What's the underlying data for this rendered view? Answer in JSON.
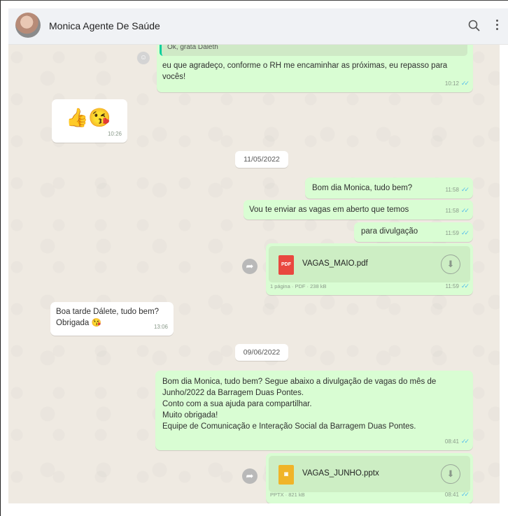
{
  "header": {
    "contact_name": "Monica Agente De Saúde",
    "avatar_icon": "avatar-photo",
    "search_icon": "search-icon",
    "menu_icon": "kebab-menu-icon"
  },
  "messages": {
    "m1": {
      "quote": "Ok, grata Daleth",
      "text": "eu que agradeço, conforme o RH me encaminhar as próximas, eu repasso para vocês!",
      "time": "10:12"
    },
    "m2": {
      "emoji": "👍😘",
      "time": "10:26"
    },
    "date1": "11/05/2022",
    "m3": {
      "text": "Bom dia Monica, tudo bem?",
      "time": "11:58"
    },
    "m4": {
      "text": "Vou te enviar as vagas em aberto que temos",
      "time": "11:58"
    },
    "m5": {
      "text": "para divulgação",
      "time": "11:59"
    },
    "m6": {
      "file_name": "VAGAS_MAIO.pdf",
      "file_type": "PDF",
      "file_info": "1 página · PDF · 238 kB",
      "time": "11:59"
    },
    "m7": {
      "line1": "Boa tarde Dálete, tudo bem?",
      "line2": "Obrigada 😘",
      "time": "13:06"
    },
    "date2": "09/06/2022",
    "m8": {
      "line1": "Bom dia Monica, tudo bem? Segue abaixo a divulgação de vagas do mês de",
      "line2": "Junho/2022 da Barragem Duas Pontes.",
      "line3": "Conto com a sua ajuda para compartilhar.",
      "line4": "Muito obrigada!",
      "line5": "Equipe de Comunicação e Interação Social da Barragem Duas Pontes.",
      "time": "08:41"
    },
    "m9": {
      "file_name": "VAGAS_JUNHO.pptx",
      "file_type": "PPTX",
      "file_info": "PPTX · 821 kB",
      "time": "08:41"
    }
  },
  "colors": {
    "outgoing": "#d9fdd3",
    "incoming": "#ffffff",
    "read_ticks": "#53bdeb",
    "pdf": "#e9483f",
    "pptx": "#f0b429"
  }
}
